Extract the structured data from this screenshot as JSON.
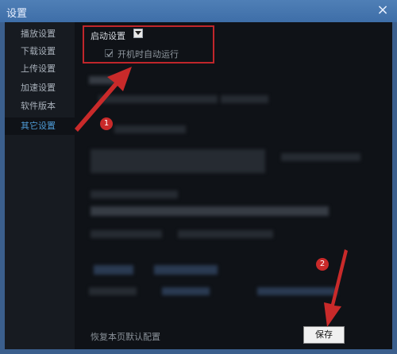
{
  "window": {
    "title": "设置",
    "close_glyph": "×"
  },
  "sidebar": {
    "items": [
      {
        "label": "播放设置"
      },
      {
        "label": "下载设置"
      },
      {
        "label": "上传设置"
      },
      {
        "label": "加速设置"
      },
      {
        "label": "软件版本"
      },
      {
        "label": "其它设置"
      }
    ],
    "active_index": 5
  },
  "startup": {
    "section_label": "启动设置",
    "checkbox_label": "开机时自动运行",
    "checkbox_checked": true
  },
  "footer": {
    "restore_defaults_text": "恢复本页默认配置",
    "save_label": "保存"
  },
  "annotations": {
    "badge1": "1",
    "badge2": "2",
    "color": "#c92a2a"
  },
  "colors": {
    "accent": "#4e9bd6",
    "highlight_border": "#c0262b",
    "background": "#0f1217"
  }
}
